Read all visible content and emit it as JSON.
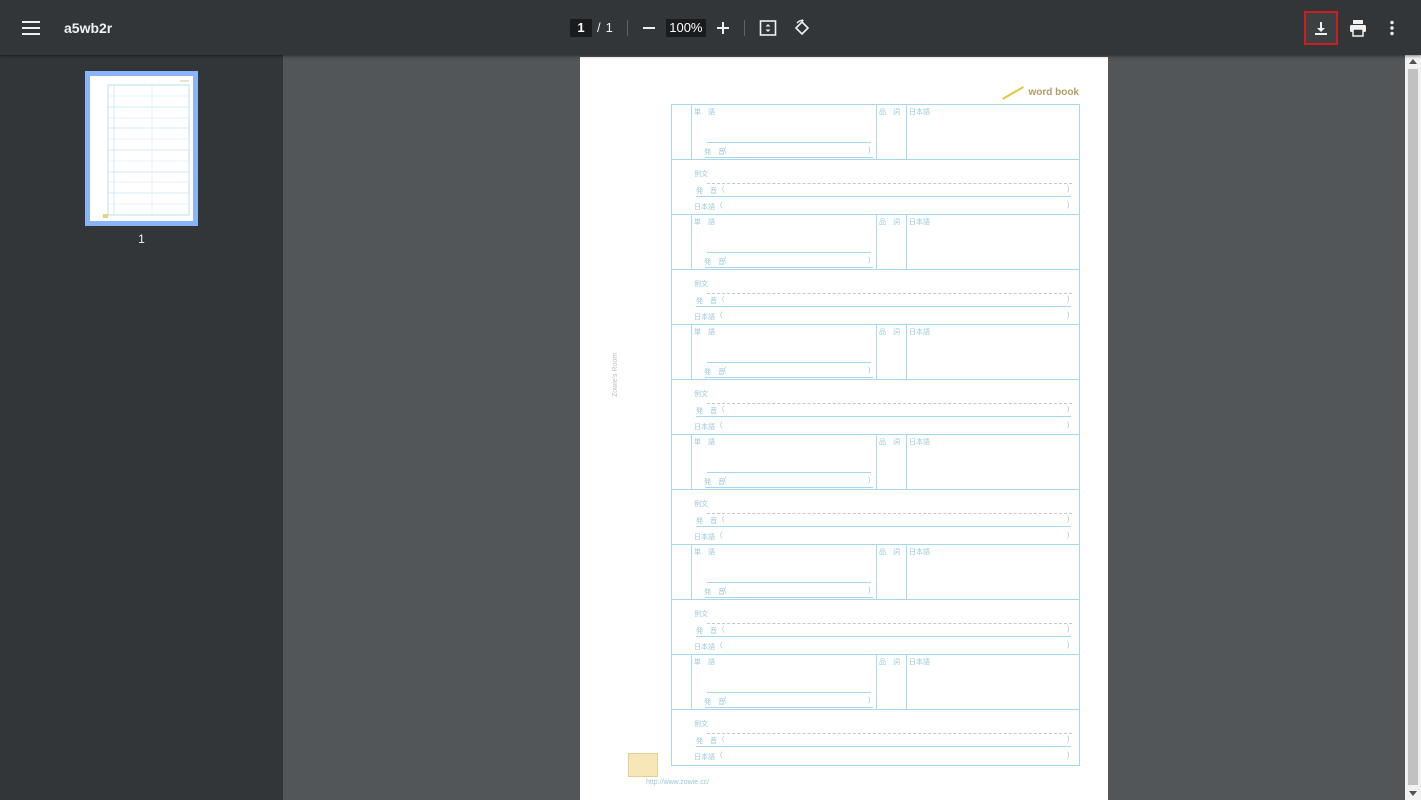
{
  "toolbar": {
    "title": "a5wb2r",
    "page_current": "1",
    "page_sep": "/",
    "page_total": "1",
    "zoom": "100%"
  },
  "thumbnail": {
    "page_label": "1"
  },
  "page": {
    "brand": "word book",
    "side_credit": "Zowie's Room",
    "url": "http://www.zowie.cc/",
    "labels": {
      "word": "単　語",
      "pos": "品　詞",
      "japanese": "日本語",
      "pronunciation": "発　音",
      "example": "例文",
      "ex_pronunciation": "発　音",
      "ex_japanese": "日本語",
      "open_paren": "(",
      "close_paren": ")"
    }
  },
  "colors": {
    "toolbar": "#323639",
    "viewer": "#525659",
    "grid": "#a8d8f0",
    "highlight": "#d01c1c"
  }
}
